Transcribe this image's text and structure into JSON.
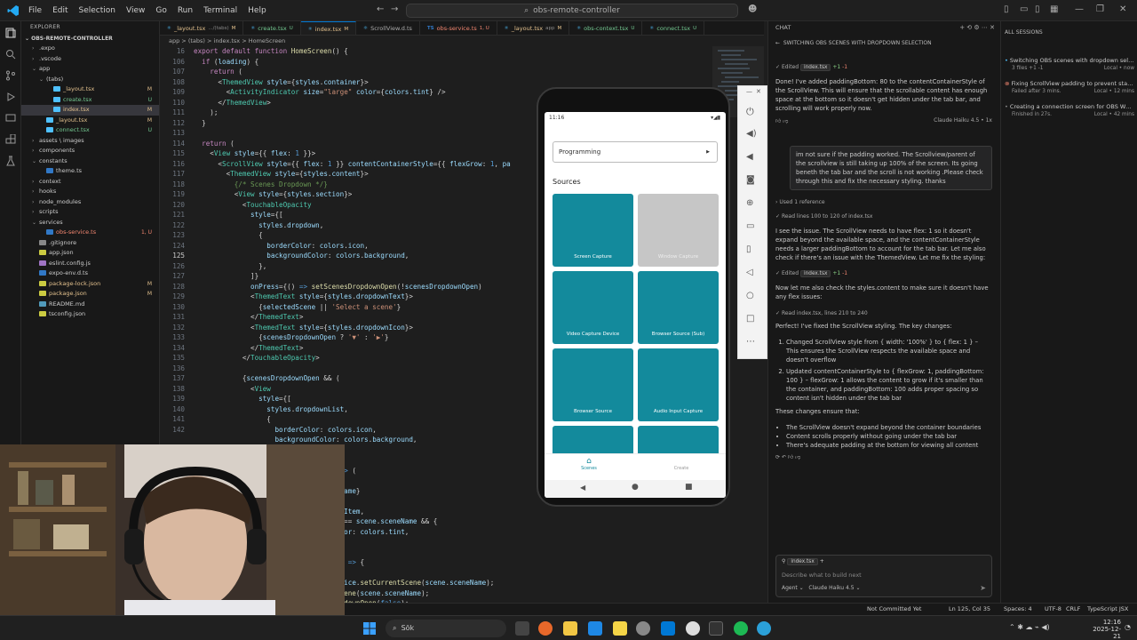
{
  "titlebar": {
    "menus": [
      "File",
      "Edit",
      "Selection",
      "View",
      "Go",
      "Run",
      "Terminal",
      "Help"
    ],
    "search_text": "obs-remote-controller"
  },
  "explorer": {
    "header": "EXPLORER",
    "root": "OBS-REMOTE-CONTROLLER",
    "items": [
      {
        "label": ".expo",
        "indent": 1,
        "folder": true,
        "status": ""
      },
      {
        "label": ".vscode",
        "indent": 1,
        "folder": true,
        "status": ""
      },
      {
        "label": "app",
        "indent": 1,
        "folder": true,
        "open": true,
        "status": ""
      },
      {
        "label": "(tabs)",
        "indent": 2,
        "folder": true,
        "open": true,
        "status": ""
      },
      {
        "label": "_layout.tsx",
        "indent": 3,
        "status": "M"
      },
      {
        "label": "create.tsx",
        "indent": 3,
        "status": "U"
      },
      {
        "label": "index.tsx",
        "indent": 3,
        "status": "M",
        "selected": true
      },
      {
        "label": "_layout.tsx",
        "indent": 2,
        "status": "M"
      },
      {
        "label": "connect.tsx",
        "indent": 2,
        "status": "U"
      },
      {
        "label": "assets \\ images",
        "indent": 1,
        "folder": true,
        "status": ""
      },
      {
        "label": "components",
        "indent": 1,
        "folder": true,
        "status": ""
      },
      {
        "label": "constants",
        "indent": 1,
        "folder": true,
        "open": true,
        "status": ""
      },
      {
        "label": "theme.ts",
        "indent": 2,
        "status": ""
      },
      {
        "label": "context",
        "indent": 1,
        "folder": true,
        "status": ""
      },
      {
        "label": "hooks",
        "indent": 1,
        "folder": true,
        "status": ""
      },
      {
        "label": "node_modules",
        "indent": 1,
        "folder": true,
        "status": ""
      },
      {
        "label": "scripts",
        "indent": 1,
        "folder": true,
        "status": ""
      },
      {
        "label": "services",
        "indent": 1,
        "folder": true,
        "open": true,
        "status": ""
      },
      {
        "label": "obs-service.ts",
        "indent": 2,
        "status": "1, U"
      },
      {
        "label": ".gitignore",
        "indent": 1,
        "status": ""
      },
      {
        "label": "app.json",
        "indent": 1,
        "status": ""
      },
      {
        "label": "eslint.config.js",
        "indent": 1,
        "status": ""
      },
      {
        "label": "expo-env.d.ts",
        "indent": 1,
        "status": ""
      },
      {
        "label": "package-lock.json",
        "indent": 1,
        "status": "M"
      },
      {
        "label": "package.json",
        "indent": 1,
        "status": "M"
      },
      {
        "label": "README.md",
        "indent": 1,
        "status": ""
      },
      {
        "label": "tsconfig.json",
        "indent": 1,
        "status": ""
      }
    ]
  },
  "tabs": [
    {
      "type": "tsx",
      "label": "_layout.tsx",
      "hint": ".../(tabs)",
      "status": "M"
    },
    {
      "type": "tsx",
      "label": "create.tsx",
      "hint": "",
      "status": "U"
    },
    {
      "type": "tsx",
      "label": "index.tsx",
      "hint": "",
      "status": "M",
      "active": true
    },
    {
      "type": "tsx",
      "label": "ScrollView.d.ts",
      "hint": "",
      "status": ""
    },
    {
      "type": "ts",
      "label": "obs-service.ts",
      "hint": "",
      "status": "1, U"
    },
    {
      "type": "tsx",
      "label": "_layout.tsx",
      "hint": "app",
      "status": "M"
    },
    {
      "type": "tsx",
      "label": "obs-context.tsx",
      "hint": "",
      "status": "U"
    },
    {
      "type": "tsx",
      "label": "connect.tsx",
      "hint": "",
      "status": "U"
    }
  ],
  "breadcrumb": "app > (tabs) > index.tsx > HomeScreen",
  "code": {
    "line_numbers": [
      "16",
      "106",
      "107",
      "108",
      "109",
      "110",
      "111",
      "112",
      "113",
      "114",
      "115",
      "116",
      "117",
      "118",
      "119",
      "120",
      "121",
      "122",
      "123",
      "124",
      "125",
      "126",
      "127",
      "128",
      "129",
      "130",
      "131",
      "132",
      "133",
      "134",
      "135",
      "136",
      "137",
      "138",
      "139",
      "140",
      "141",
      "142"
    ],
    "current_line": "125"
  },
  "phone": {
    "time": "11:16",
    "dropdown_value": "Programming",
    "dropdown_icon": "▶",
    "sources_title": "Sources",
    "sources": [
      "Screen Capture",
      "Window Capture",
      "Video Capture Device",
      "Browser Source (Sub)",
      "Browser Source",
      "Audio Input Capture"
    ],
    "tabs": [
      "Scenes",
      "Create"
    ]
  },
  "chat": {
    "header": "CHAT",
    "title": "SWITCHING OBS SCENES WITH DROPDOWN SELECTION",
    "edited_label": "Edited",
    "file_chip": "index.tsx",
    "diff_add": "+1",
    "diff_del": "-1",
    "msg1": "Done! I've added paddingBottom: 80 to the contentContainerStyle of the ScrollView. This will ensure that the scrollable content has enough space at the bottom so it doesn't get hidden under the tab bar, and scrolling will work properly now.",
    "model1": "Claude Haiku 4.5 • 1x",
    "user_msg": "im not sure if the padding worked. The Scrollview/parent of the scrollview is still taking up 100% of the screen. Its going beneth the tab bar and the scroll is not working .Please check through this and fix the necessary styling. thanks",
    "used_ref": "Used 1 reference",
    "read1": "Read lines 100 to 120 of index.tsx",
    "msg2": "I see the issue. The ScrollView needs to have flex: 1 so it doesn't expand beyond the available space, and the contentContainerStyle needs a larger paddingBottom to account for the tab bar. Let me also check if there's an issue with the ThemedView. Let me fix the styling:",
    "msg3": "Now let me also check the styles.content to make sure it doesn't have any flex issues:",
    "read2": "Read index.tsx, lines 210 to 240",
    "msg4": "Perfect! I've fixed the ScrollView styling. The key changes:",
    "change1": "Changed ScrollView style from { width: '100%' } to { flex: 1 } – This ensures the ScrollView respects the available space and doesn't overflow",
    "change2": "Updated contentContainerStyle to { flexGrow: 1, paddingBottom: 100 } – flexGrow: 1 allows the content to grow if it's smaller than the container, and paddingBottom: 100 adds proper spacing so content isn't hidden under the tab bar",
    "msg5": "These changes ensure that:",
    "bullets": [
      "The ScrollView doesn't expand beyond the container boundaries",
      "Content scrolls properly without going under the tab bar",
      "There's adequate padding at the bottom for viewing all content"
    ],
    "input_chip": "index.tsx",
    "input_placeholder": "Describe what to build next",
    "agent_label": "Agent",
    "model_label": "Claude Haiku 4.5"
  },
  "sessions": {
    "header": "ALL SESSIONS",
    "items": [
      {
        "title": "Switching OBS scenes with dropdown sele...",
        "meta": "3 files +1 -1",
        "right": "Local • now",
        "active": true
      },
      {
        "title": "Fixing ScrollView padding to prevent statu...",
        "meta": "Failed after 3 mins.",
        "right": "Local • 12 mins",
        "failed": true
      },
      {
        "title": "Creating a connection screen for OBS Web...",
        "meta": "Finished in 27s.",
        "right": "Local • 42 mins"
      }
    ]
  },
  "statusbar": {
    "git": "Not Committed Yet",
    "position": "Ln 125, Col 35",
    "spaces": "Spaces: 4",
    "encoding": "UTF-8",
    "eol": "CRLF",
    "language": "TypeScript JSX"
  },
  "taskbar": {
    "search_label": "Sök",
    "time": "12:16",
    "date": "2025-12-21"
  },
  "colors": {
    "accent": "#0078d4",
    "teal": "#138a9c",
    "editor_bg": "#1e1e1e",
    "sidebar_bg": "#181818"
  }
}
